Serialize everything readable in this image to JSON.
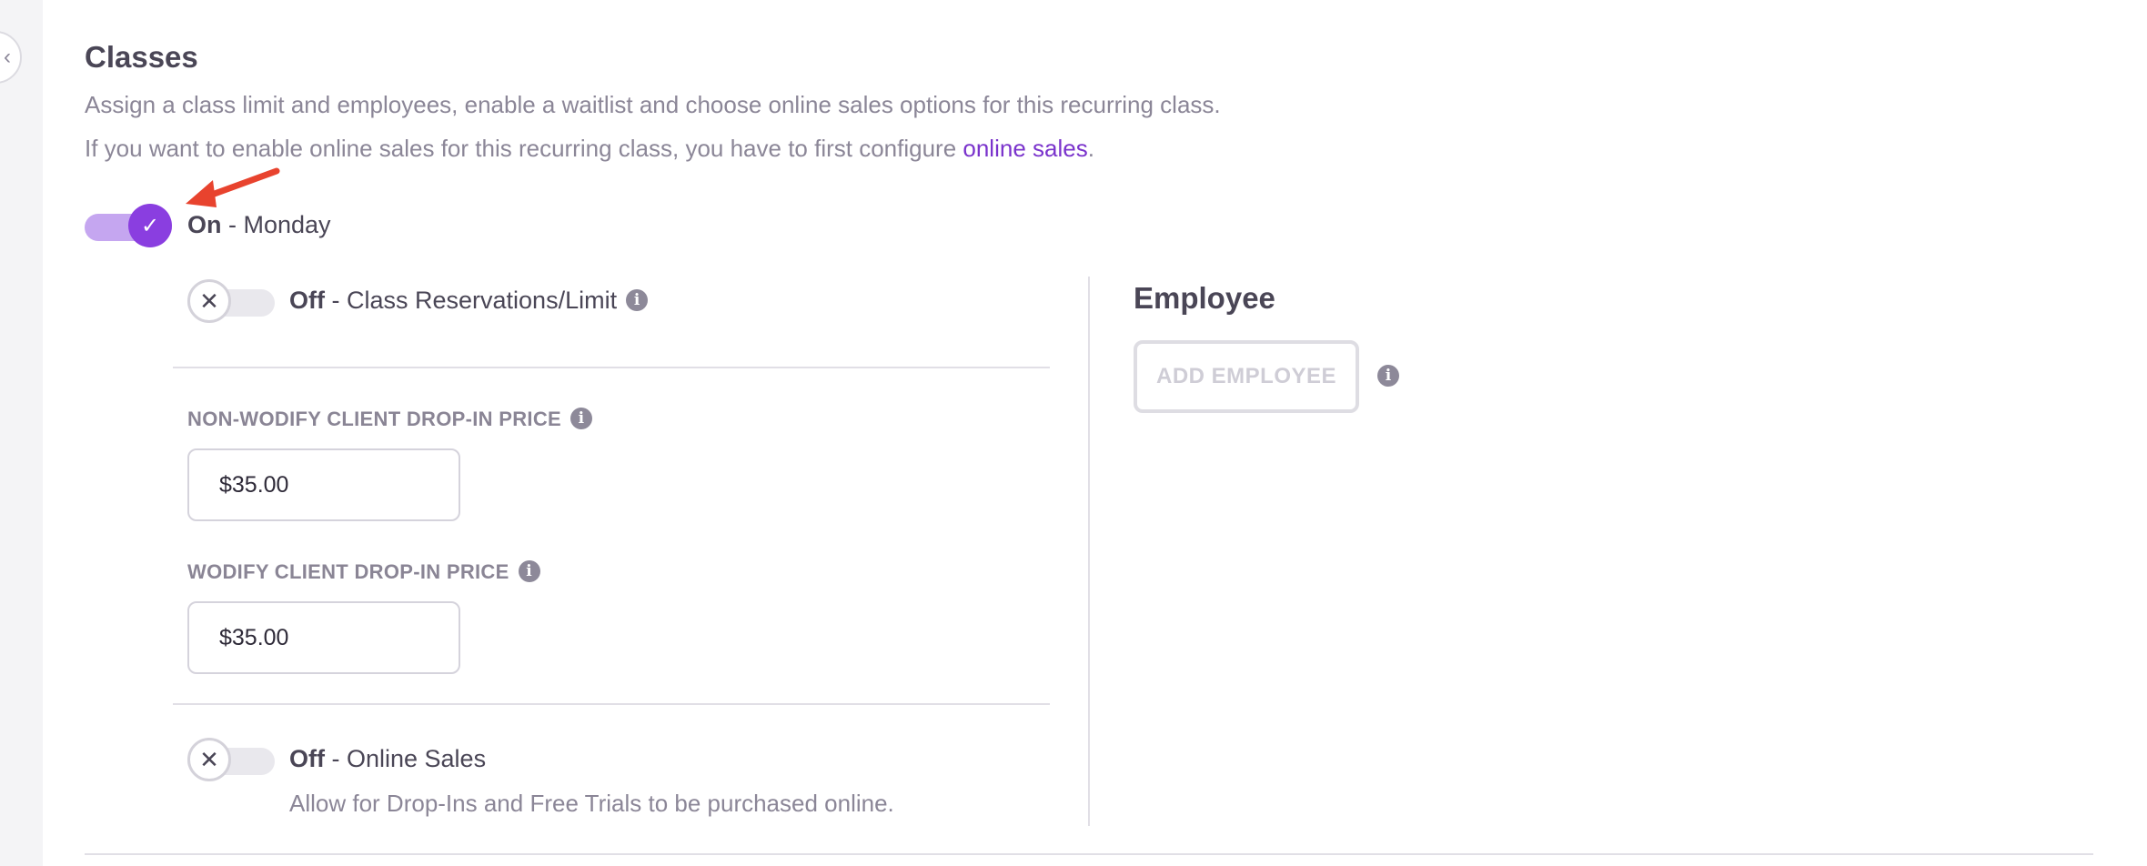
{
  "section": {
    "title": "Classes",
    "description_line1": "Assign a class limit and employees, enable a waitlist and choose online sales options for this recurring class.",
    "description_line2_prefix": "If you want to enable online sales for this recurring class, you have to first configure ",
    "online_sales_link": "online sales",
    "description_line2_suffix": "."
  },
  "day_toggle": {
    "state": "On",
    "label": " - Monday"
  },
  "reservations_toggle": {
    "state": "Off",
    "label": " - Class Reservations/Limit"
  },
  "prices": {
    "non_wodify_label": "NON-WODIFY CLIENT DROP-IN PRICE",
    "non_wodify_value": "$35.00",
    "wodify_label": "WODIFY CLIENT DROP-IN PRICE",
    "wodify_value": "$35.00"
  },
  "online_sales_toggle": {
    "state": "Off",
    "label": " - Online Sales",
    "description": "Allow for Drop-Ins and Free Trials to be purchased online."
  },
  "employee": {
    "title": "Employee",
    "add_button": "ADD EMPLOYEE"
  },
  "icons": {
    "info": "i",
    "check": "✓",
    "close": "✕",
    "collapse": "‹"
  },
  "colors": {
    "accent": "#8a3ee0",
    "link": "#7a33cc",
    "annotation_arrow": "#e8432e"
  }
}
